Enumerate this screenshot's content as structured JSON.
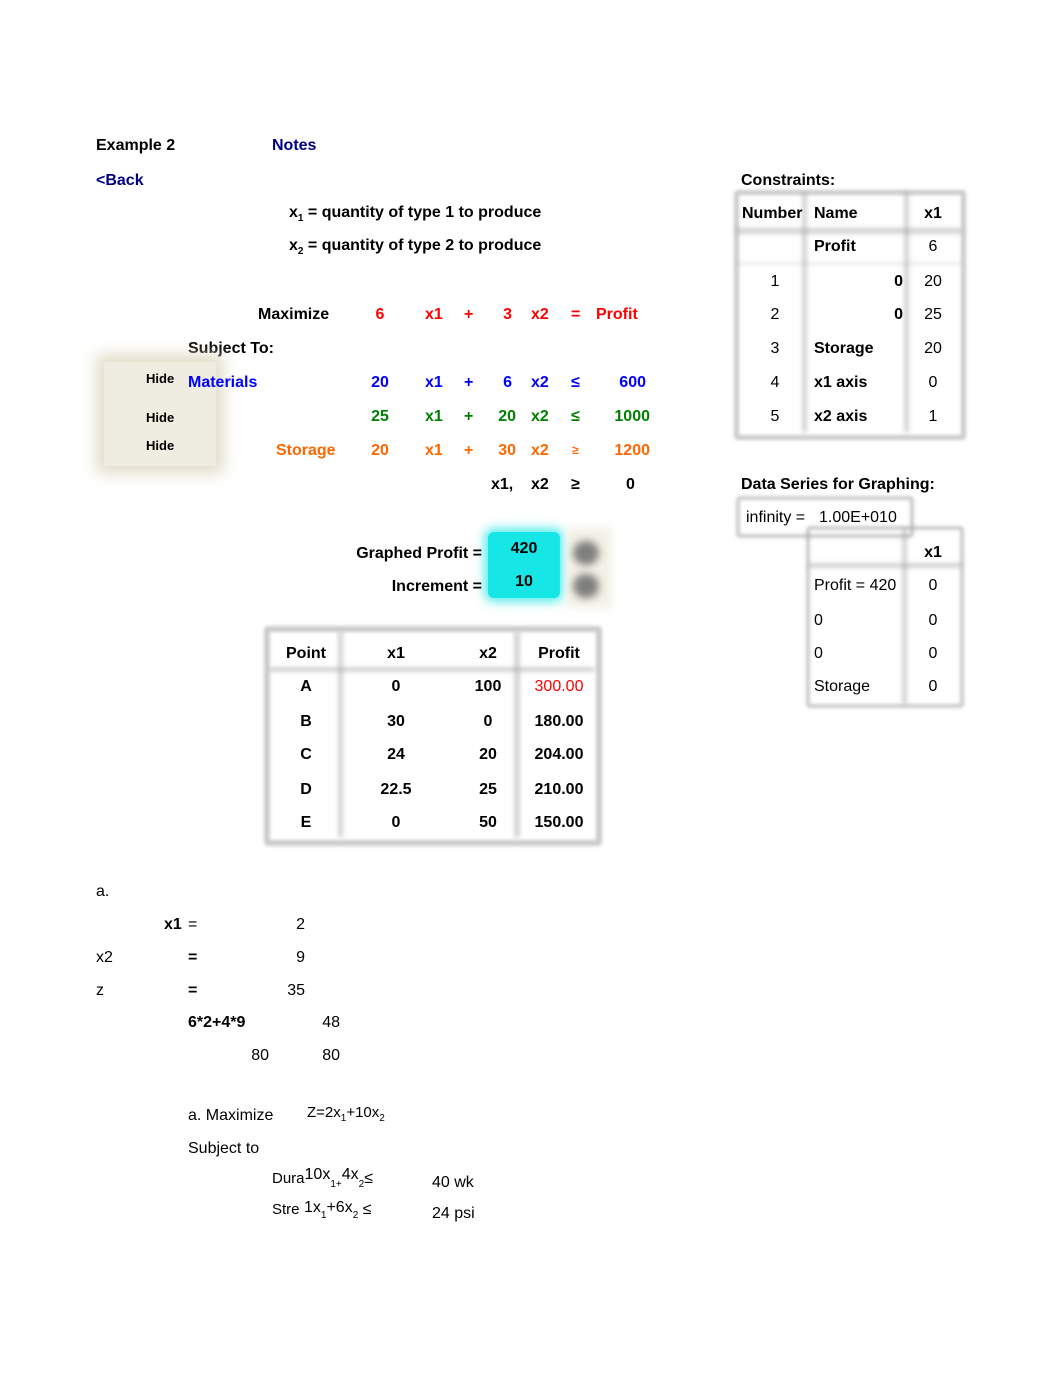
{
  "header": {
    "title": "Example 2",
    "notes_link": "Notes",
    "back_link": "<Back"
  },
  "definitions": [
    {
      "var": "x",
      "sub": "1",
      "text": " = quantity of type 1 to produce"
    },
    {
      "var": "x",
      "sub": "2",
      "text": " = quantity of type 2 to produce"
    }
  ],
  "objective": {
    "label": "Maximize",
    "c1": "6",
    "v1": "x1",
    "plus": "+",
    "c2": "3",
    "v2": "x2",
    "eq": "=",
    "rhs": "Profit"
  },
  "subject_to_label": "Subject To:",
  "hide_buttons": [
    "Hide",
    "Hide",
    "Hide"
  ],
  "constraints": [
    {
      "name": "Materials",
      "c1": "20",
      "v1": "x1",
      "plus": "+",
      "c2": "6",
      "v2": "x2",
      "op": "≤",
      "rhs": "600",
      "color": "#0000ff"
    },
    {
      "name": "",
      "c1": "25",
      "v1": "x1",
      "plus": "+",
      "c2": "20",
      "v2": "x2",
      "op": "≤",
      "rhs": "1000",
      "color": "#008000"
    },
    {
      "name": "Storage",
      "c1": "20",
      "v1": "x1",
      "plus": "+",
      "c2": "30",
      "v2": "x2",
      "op": "≥",
      "rhs": "1200",
      "color": "#ff6600"
    }
  ],
  "nonneg": {
    "v1": "x1,",
    "v2": "x2",
    "op": "≥",
    "rhs": "0"
  },
  "graphed": {
    "profit_label": "Graphed Profit =",
    "profit_value": "420",
    "increment_label": "Increment =",
    "increment_value": "10"
  },
  "points_table": {
    "headers": [
      "Point",
      "x1",
      "x2",
      "Profit"
    ],
    "rows": [
      {
        "point": "A",
        "x1": "0",
        "x2": "100",
        "profit": "300.00",
        "highlight": true
      },
      {
        "point": "B",
        "x1": "30",
        "x2": "0",
        "profit": "180.00"
      },
      {
        "point": "C",
        "x1": "24",
        "x2": "20",
        "profit": "204.00"
      },
      {
        "point": "D",
        "x1": "22.5",
        "x2": "25",
        "profit": "210.00"
      },
      {
        "point": "E",
        "x1": "0",
        "x2": "50",
        "profit": "150.00"
      }
    ]
  },
  "constraints_table": {
    "title": "Constraints:",
    "headers": [
      "Number",
      "Name",
      "x1"
    ],
    "rows": [
      {
        "number": "",
        "name": "Profit",
        "extra": "",
        "x1": "6"
      },
      {
        "number": "1",
        "name": "",
        "extra": "0",
        "x1": "20"
      },
      {
        "number": "2",
        "name": "",
        "extra": "0",
        "x1": "25"
      },
      {
        "number": "3",
        "name": "Storage",
        "extra": "",
        "x1": "20"
      },
      {
        "number": "4",
        "name": "x1 axis",
        "extra": "",
        "x1": "0"
      },
      {
        "number": "5",
        "name": "x2 axis",
        "extra": "",
        "x1": "1"
      }
    ]
  },
  "data_series": {
    "title": "Data Series for Graphing:",
    "infinity_label": "infinity =",
    "infinity_value": "1.00E+010",
    "header_x1": "x1",
    "rows": [
      {
        "label": "Profit = 420",
        "x1": "0"
      },
      {
        "label": "0",
        "x1": "0"
      },
      {
        "label": "0",
        "x1": "0"
      },
      {
        "label": "Storage",
        "x1": "0"
      }
    ]
  },
  "work_a": {
    "label": "a.",
    "x1_label": "x1",
    "x1_eq": "=",
    "x1_val": "2",
    "x2_label": "x2",
    "x2_eq": "=",
    "x2_val": "9",
    "z_label": "z",
    "z_eq": "=",
    "z_val": "35",
    "expr": "6*2+4*9",
    "expr_val": "48",
    "row_a": "80",
    "row_b": "80"
  },
  "problem": {
    "maximize_label": "a. Maximize",
    "objective": {
      "pre": "Z=2x",
      "s1": "1",
      "mid": "+10x",
      "s2": "2"
    },
    "subject_to": "Subject to",
    "c1": {
      "name": "Dura",
      "a": "10x",
      "s1": "1+",
      "b": "4x",
      "s2": "2",
      "op": "≤",
      "rhs": "40 wk"
    },
    "c2": {
      "name": "Stre",
      "a": "1x",
      "s1": "1",
      "b": "+6x",
      "s2": "2",
      "op": "≤",
      "rhs": "24 psi"
    }
  }
}
